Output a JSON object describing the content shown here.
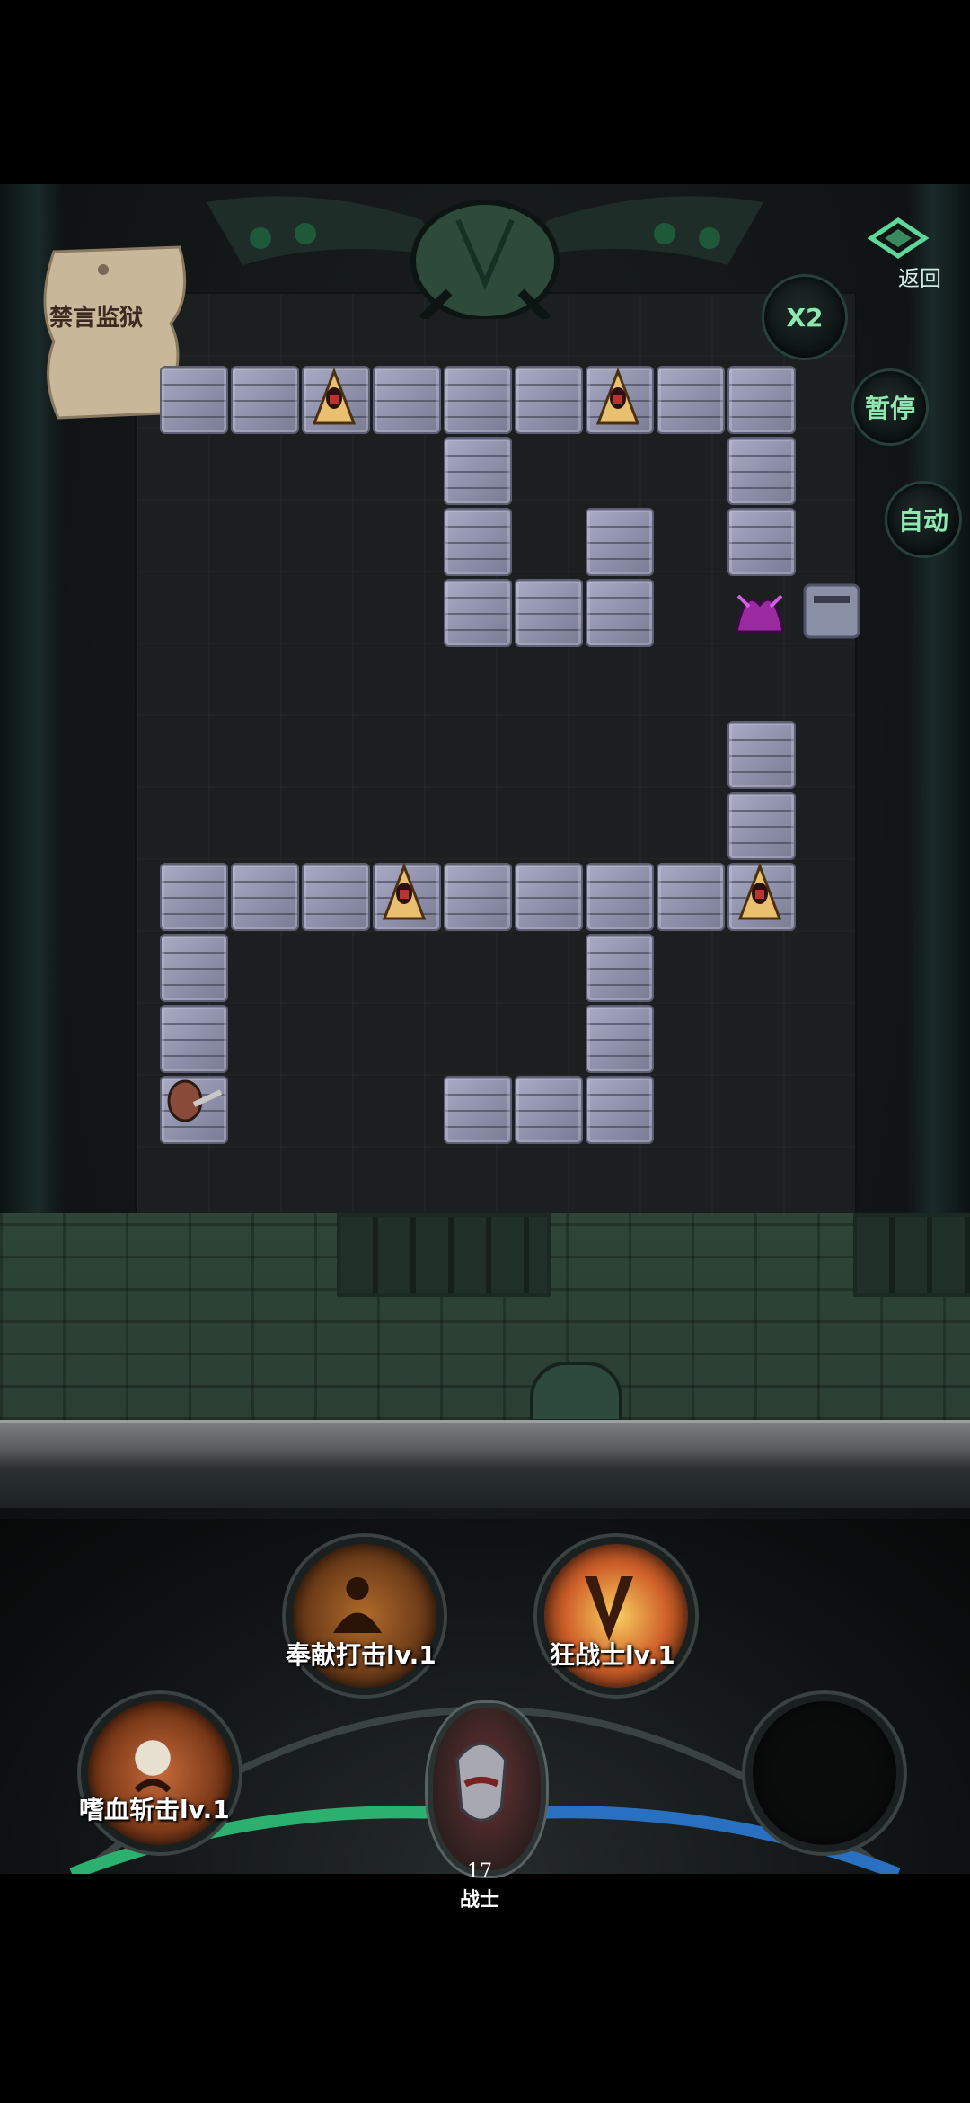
{
  "level": {
    "name": "禁言监狱"
  },
  "controls": {
    "back_label": "返回",
    "speed_label": "X2",
    "pause_label": "暂停",
    "auto_label": "自动"
  },
  "skills": [
    {
      "label": "奉献打击lv.1",
      "icon": "devotion-strike-icon"
    },
    {
      "label": "狂战士lv.1",
      "icon": "berserker-icon"
    },
    {
      "label": "嗜血斩击lv.1",
      "icon": "bloodthirst-slash-icon"
    },
    {
      "label": "",
      "icon": "empty-skill-slot"
    }
  ],
  "hero": {
    "level": "17",
    "class": "战士"
  },
  "colors": {
    "accent": "#8ee8b0",
    "tile": "#9c9eb8",
    "wall": "#2d4436"
  }
}
